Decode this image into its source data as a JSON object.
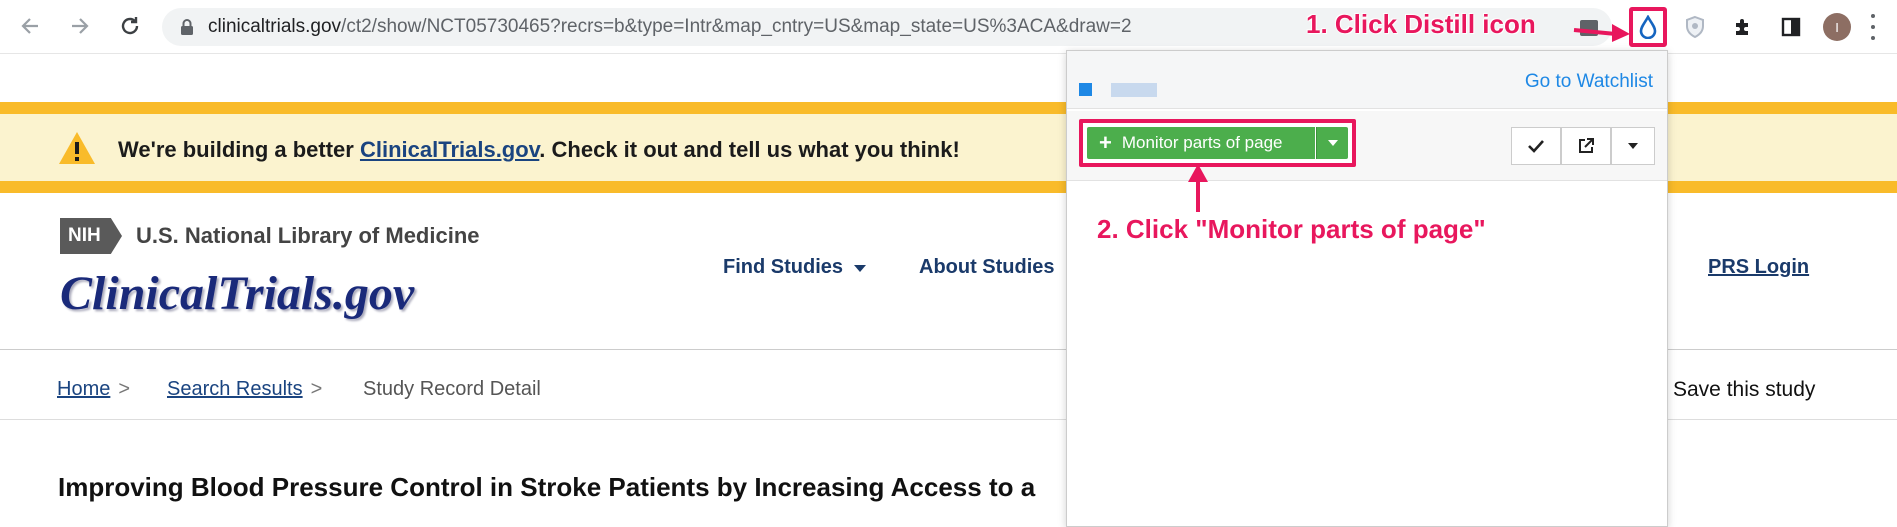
{
  "browser": {
    "url_domain": "clinicaltrials.gov",
    "url_path": "/ct2/show/NCT05730465?recrs=b&type=Intr&map_cntry=US&map_state=US%3ACA&draw=2",
    "avatar_initial": "I"
  },
  "annotations": {
    "step1": "1. Click Distill icon",
    "step2": "2. Click \"Monitor parts of page\""
  },
  "banner": {
    "prefix": "We're building a better ",
    "link": "ClinicalTrials.gov",
    "suffix": ". Check it out and tell us what you think!"
  },
  "header": {
    "nih_badge": "NIH",
    "nih_text": "U.S. National Library of Medicine",
    "logo": "ClinicalTrials.gov",
    "nav": {
      "find_studies": "Find Studies",
      "about_studies": "About Studies",
      "prs_login": "PRS Login"
    }
  },
  "breadcrumb": {
    "home": "Home",
    "search_results": "Search Results",
    "current": "Study Record Detail",
    "separator": ">"
  },
  "save_study": "Save this study",
  "study_title": "Improving Blood Pressure Control in Stroke Patients by Increasing Access to a",
  "popup": {
    "go_to_watchlist": "Go to Watchlist",
    "monitor_button": "Monitor parts of page",
    "monitor_icon": "plus-icon",
    "tools": [
      "check-icon",
      "external-link-icon",
      "caret-down-icon"
    ]
  },
  "colors": {
    "annotation": "#e8175d",
    "banner_border": "#f9bb2a",
    "banner_bg": "#fbf3cf",
    "monitor_green": "#4cae4c",
    "link_blue": "#1e88e5"
  }
}
